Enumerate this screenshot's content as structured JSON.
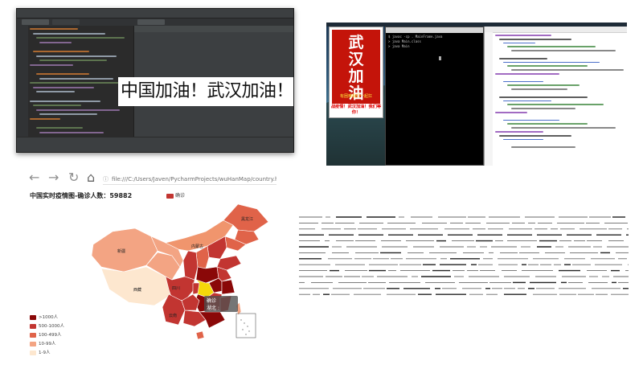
{
  "slogan": "中国加油！武汉加油！",
  "poster": {
    "calligraphy": [
      "武",
      "汉",
      "加",
      "油"
    ],
    "caption": "有困难我们一起扛",
    "bottom_text": "战疫情！武汉加油！我们等你！"
  },
  "terminal": {
    "lines": [
      "$ javac -cp . MainFrame.java",
      "> java Main.class",
      "> java Main"
    ]
  },
  "browser": {
    "url": "file:///C:/Users/Javen/PycharmProjects/wuHanMap/country.html",
    "nav_icons": [
      "back-icon",
      "forward-icon",
      "reload-icon",
      "home-icon"
    ]
  },
  "map": {
    "title": "中国实时疫情图-确诊人数：59882",
    "legend_label": "确诊",
    "tooltip": {
      "name": "确诊",
      "value_text": "湖北 : 48,206"
    },
    "provinces_labeled": [
      "新疆",
      "西藏",
      "黑龙江",
      "内蒙古",
      "四川",
      "云南",
      "湖北"
    ],
    "pieces": [
      {
        "label": ">1000人",
        "color": "#8a0808"
      },
      {
        "label": "500-1000人",
        "color": "#c23531"
      },
      {
        "label": "100-499人",
        "color": "#e06349"
      },
      {
        "label": "10-99人",
        "color": "#f3a483"
      },
      {
        "label": "1-9人",
        "color": "#fde7cf"
      }
    ]
  },
  "colors": {
    "ide_bg": "#2b2b2b",
    "poster_red": "#c4140a",
    "map_highlight": "#f5d80a"
  }
}
